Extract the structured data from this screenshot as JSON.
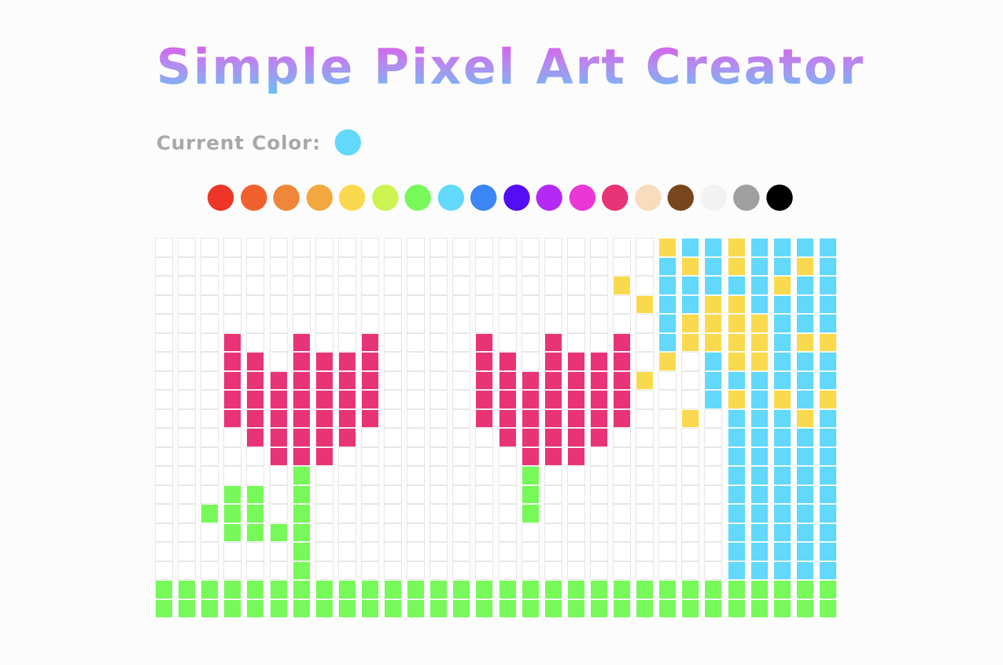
{
  "title": "Simple Pixel Art Creator",
  "current_color": {
    "label": "Current Color:",
    "value": "#62d8fa"
  },
  "palette": [
    {
      "name": "red",
      "color": "#ee3528"
    },
    {
      "name": "orange-red",
      "color": "#f0612e"
    },
    {
      "name": "orange",
      "color": "#f08638"
    },
    {
      "name": "light-orange",
      "color": "#f2a83e"
    },
    {
      "name": "yellow",
      "color": "#f9da4f"
    },
    {
      "name": "lime",
      "color": "#cbf450"
    },
    {
      "name": "green",
      "color": "#77f95a"
    },
    {
      "name": "light-blue",
      "color": "#62d8fa"
    },
    {
      "name": "blue",
      "color": "#3c86f5"
    },
    {
      "name": "indigo",
      "color": "#540ef5"
    },
    {
      "name": "purple",
      "color": "#b42af4"
    },
    {
      "name": "magenta",
      "color": "#ea37d6"
    },
    {
      "name": "pink",
      "color": "#e83477"
    },
    {
      "name": "peach",
      "color": "#f9dcbd"
    },
    {
      "name": "brown",
      "color": "#77461c"
    },
    {
      "name": "white",
      "color": "#f2f2f2"
    },
    {
      "name": "gray",
      "color": "#9f9f9f"
    },
    {
      "name": "black",
      "color": "#000000"
    }
  ],
  "grid": {
    "legend": {
      ".": "#ffffff",
      "P": "#e83477",
      "G": "#77f95a",
      "Y": "#f9da4f",
      "B": "#62d8fa"
    },
    "rows": [
      "......................YBBYBBBB",
      "......................BYBYBBYB",
      "....................Y.BBBBBYBB",
      ".....................YBBYYBBBB",
      "......................BYYYYBBB",
      "...P..P..P....P..P..P.BYYYYBYY",
      "...PP.PPPP....PP.PPPP.Y.BYYBBB",
      "...PPPPPPP....PPPPPPPY..BBBBBB",
      "...PPPPPPP....PPPPPPP...BYBYBY",
      "...PPPPPPP....PPPPPPP..Y.BBBYB",
      "....PPPPP......PPPPP.....BBBBB",
      ".....PPP........PPP......BBBBB",
      "......G.........G........BBBBB",
      "...GG.G.........G........BBBBB",
      "..GGG.G.........G........BBBBB",
      "...GGGG..................BBBBB",
      "......G..................BBBBB",
      "......G..................BBBBB",
      "GGGGGGGGGGGGGGGGGGGGGGGGGGGGGG",
      "GGGGGGGGGGGGGGGGGGGGGGGGGGGGGG"
    ]
  }
}
